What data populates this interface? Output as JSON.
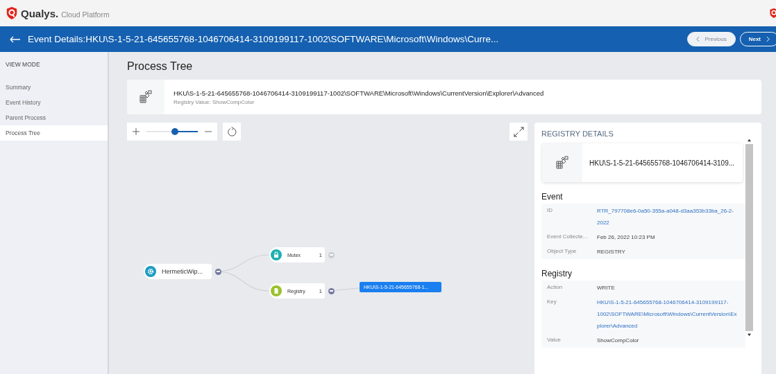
{
  "header": {
    "brand": "Qualys.",
    "product": "Cloud Platform"
  },
  "event_bar": {
    "title": "Event Details:HKU\\S-1-5-21-645655768-1046706414-3109199117-1002\\SOFTWARE\\Microsoft\\Windows\\Curre...",
    "buttons": [
      {
        "label": "Previous",
        "kind": "previous",
        "disabled": true
      },
      {
        "label": "Next",
        "kind": "next",
        "disabled": false
      }
    ]
  },
  "sidebar": {
    "heading": "VIEW MODE",
    "items": [
      {
        "label": "Summary",
        "selected": false
      },
      {
        "label": "Event History",
        "selected": false
      },
      {
        "label": "Parent Process",
        "selected": false
      },
      {
        "label": "Process Tree",
        "selected": true
      }
    ]
  },
  "page_title": "Process Tree",
  "summary_card": {
    "path": "HKU\\S-1-5-21-645655768-1046706414-3109199117-1002\\SOFTWARE\\Microsoft\\Windows\\CurrentVersion\\Explorer\\Advanced",
    "value_label": "Registry Value:",
    "value": "ShowCompColor"
  },
  "tree": {
    "label": "HermeticWip...",
    "kind": "process",
    "expanded": true,
    "children": [
      {
        "label": "Mutex",
        "kind": "mutex",
        "count": "1",
        "expanded": false
      },
      {
        "label": "Registry",
        "kind": "registry",
        "count": "1",
        "expanded": true,
        "children": [
          {
            "label": "HKU\\S-1-5-21-645655768-1...",
            "kind": "key"
          }
        ]
      }
    ]
  },
  "details": {
    "title": "REGISTRY DETAILS",
    "card_title": "HKU\\S-1-5-21-645655768-1046706414-3109...",
    "sections": [
      {
        "heading": "Event",
        "rows": [
          {
            "label": "ID",
            "value": "RTR_797708e6-0a50-355a-a048-d3aa353b33ba_26-2-2022",
            "link": true
          },
          {
            "label": "Event Collecte...",
            "value": "Feb 26, 2022 10:23 PM",
            "link": false
          },
          {
            "label": "Object Type",
            "value": "REGISTRY",
            "link": false
          }
        ]
      },
      {
        "heading": "Registry",
        "rows": [
          {
            "label": "Action",
            "value": "WRITE",
            "link": false
          },
          {
            "label": "Key",
            "value": "HKU\\S-1-5-21-645655768-1046706414-3109199117-1002\\SOFTWARE\\Microsoft\\Windows\\CurrentVersion\\Explorer\\Advanced",
            "link": true
          },
          {
            "label": "Value",
            "value": "ShowCompColor",
            "link": false
          }
        ]
      }
    ]
  }
}
